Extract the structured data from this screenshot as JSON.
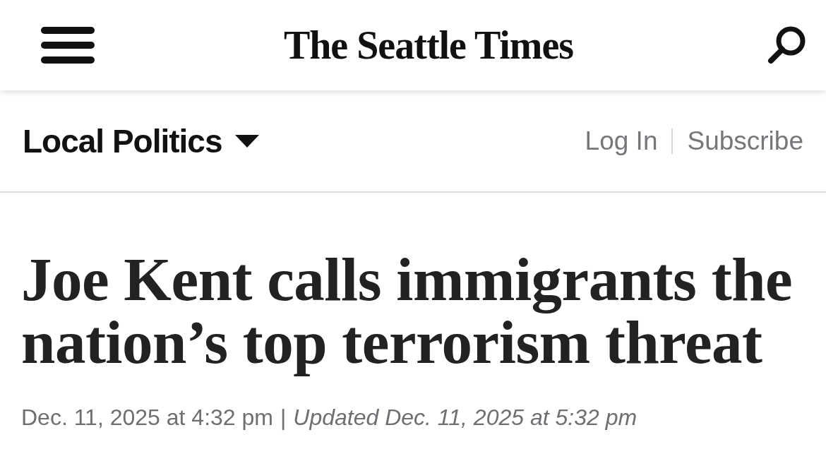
{
  "header": {
    "logo": "The Seattle Times"
  },
  "section_bar": {
    "section": "Local Politics",
    "links": [
      "Log In",
      "Subscribe"
    ]
  },
  "article": {
    "headline": "Joe Kent calls immigrants the nation’s top terrorism threat",
    "published": "Dec. 11, 2025 at 4:32 pm",
    "separator": "|",
    "updated": "Updated Dec. 11, 2025 at 5:32 pm"
  }
}
